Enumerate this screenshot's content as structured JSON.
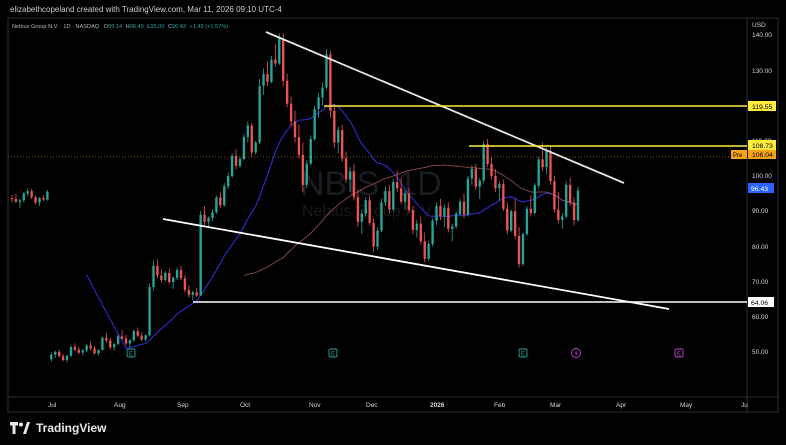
{
  "caption": "elizabethcopeland created with TradingView.com, Mar 11, 2026 09:10 UTC-4",
  "symbol": {
    "name": "Nebius Group N.V. · 1D · NASDAQ",
    "o_label": "O",
    "o_value": "95.14",
    "h_label": "H",
    "h_value": "98.40",
    "l_label": "L",
    "l_value": "95.00",
    "c_label": "C",
    "c_value": "96.43",
    "change": "+1.49 (+1.57%)"
  },
  "watermark": {
    "ticker": "NBIS, 1D",
    "name": "Nebius Group N.V."
  },
  "currency": "USD",
  "price_axis": {
    "ticks": [
      "140.00",
      "130.00",
      "110.00",
      "100.00",
      "90.00",
      "80.00",
      "70.00",
      "60.00",
      "50.00"
    ]
  },
  "time_axis": {
    "ticks": [
      "Jul",
      "Aug",
      "Sep",
      "Oct",
      "Nov",
      "Dec",
      "2026",
      "Feb",
      "Mar",
      "Apr",
      "May",
      "Ju"
    ]
  },
  "price_labels": {
    "level_1": "119.55",
    "level_2": "108.73",
    "pre_tag": "Pre",
    "pre_value": "106.04",
    "last": "96.43",
    "level_3": "64.06"
  },
  "event_markers": [
    "E",
    "E",
    "E",
    "E"
  ],
  "brand": "TradingView",
  "colors": {
    "background": "#000000",
    "up_candle": "#26a69a",
    "down_candle": "#ef5350",
    "ma_fast": "#2a2ecd",
    "ma_slow": "#8a4a4a",
    "resistance": "#ffeb3b",
    "support": "#ffffff",
    "pre_market": "#f7a21b",
    "last_price": "#2962ff"
  },
  "chart_data": {
    "type": "candlestick",
    "price_range": [
      47,
      143
    ],
    "x_range_months": [
      "Jul",
      "Aug",
      "Sep",
      "Oct",
      "Nov",
      "Dec",
      "2026",
      "Feb",
      "Mar",
      "Apr",
      "May",
      "Ju"
    ],
    "candles": [
      [
        94.2,
        95.1,
        93.0,
        94.0
      ],
      [
        94.0,
        95.5,
        92.8,
        93.2
      ],
      [
        93.2,
        94.0,
        91.5,
        93.6
      ],
      [
        93.6,
        96.0,
        93.0,
        95.5
      ],
      [
        95.5,
        97.0,
        94.8,
        96.2
      ],
      [
        96.2,
        96.8,
        94.0,
        94.5
      ],
      [
        94.5,
        95.0,
        92.5,
        93.0
      ],
      [
        93.0,
        94.5,
        92.0,
        94.2
      ],
      [
        94.2,
        95.0,
        93.4,
        93.8
      ],
      [
        93.8,
        96.5,
        93.5,
        96.0
      ],
      [
        48.5,
        50.5,
        47.8,
        49.8
      ],
      [
        49.8,
        51.0,
        48.9,
        50.6
      ],
      [
        50.6,
        51.2,
        49.0,
        49.4
      ],
      [
        49.4,
        50.0,
        47.9,
        48.3
      ],
      [
        48.3,
        49.8,
        47.6,
        49.5
      ],
      [
        49.5,
        52.5,
        49.2,
        52.0
      ],
      [
        52.0,
        53.0,
        50.8,
        51.2
      ],
      [
        51.2,
        52.0,
        49.9,
        50.4
      ],
      [
        50.4,
        51.5,
        49.6,
        51.0
      ],
      [
        51.0,
        52.8,
        50.5,
        52.4
      ],
      [
        52.4,
        53.6,
        51.0,
        51.6
      ],
      [
        51.6,
        52.3,
        49.8,
        50.2
      ],
      [
        50.2,
        51.4,
        49.5,
        51.1
      ],
      [
        51.1,
        55.0,
        51.0,
        54.6
      ],
      [
        54.6,
        56.0,
        53.2,
        53.8
      ],
      [
        53.8,
        54.5,
        51.2,
        51.9
      ],
      [
        51.9,
        53.2,
        51.0,
        52.8
      ],
      [
        52.8,
        55.5,
        52.5,
        55.0
      ],
      [
        55.0,
        56.8,
        54.0,
        54.4
      ],
      [
        54.4,
        55.4,
        52.4,
        53.0
      ],
      [
        53.0,
        54.2,
        52.0,
        53.9
      ],
      [
        53.9,
        57.0,
        53.5,
        56.5
      ],
      [
        56.5,
        57.5,
        54.8,
        55.2
      ],
      [
        55.2,
        56.3,
        53.6,
        54.1
      ],
      [
        54.1,
        55.6,
        53.5,
        55.3
      ],
      [
        55.3,
        70.0,
        55.0,
        69.0
      ],
      [
        69.0,
        76.5,
        68.0,
        75.0
      ],
      [
        75.0,
        76.8,
        71.5,
        72.3
      ],
      [
        72.3,
        74.0,
        70.2,
        71.0
      ],
      [
        71.0,
        73.5,
        70.6,
        73.0
      ],
      [
        73.0,
        74.2,
        69.8,
        70.4
      ],
      [
        70.4,
        72.0,
        68.5,
        71.6
      ],
      [
        71.6,
        74.5,
        71.0,
        73.8
      ],
      [
        73.8,
        75.0,
        71.0,
        71.5
      ],
      [
        71.5,
        72.4,
        67.5,
        68.2
      ],
      [
        68.2,
        69.5,
        66.0,
        66.8
      ],
      [
        66.8,
        68.0,
        65.2,
        67.5
      ],
      [
        67.5,
        68.8,
        66.2,
        66.6
      ],
      [
        66.6,
        90.5,
        66.5,
        89.5
      ],
      [
        89.5,
        92.0,
        86.5,
        87.5
      ],
      [
        87.5,
        89.0,
        85.6,
        88.6
      ],
      [
        88.6,
        91.0,
        87.8,
        90.2
      ],
      [
        90.2,
        95.0,
        89.8,
        94.4
      ],
      [
        94.4,
        96.0,
        91.5,
        92.2
      ],
      [
        92.2,
        98.5,
        91.8,
        97.6
      ],
      [
        97.6,
        101.5,
        96.8,
        100.5
      ],
      [
        100.5,
        107.0,
        100.0,
        106.2
      ],
      [
        106.2,
        108.0,
        102.5,
        103.4
      ],
      [
        103.4,
        106.0,
        102.8,
        105.3
      ],
      [
        105.3,
        112.5,
        105.0,
        111.6
      ],
      [
        111.6,
        116.0,
        110.0,
        114.8
      ],
      [
        114.8,
        115.5,
        106.0,
        107.2
      ],
      [
        107.2,
        110.5,
        106.5,
        110.0
      ],
      [
        110.0,
        128.0,
        109.5,
        126.0
      ],
      [
        126.0,
        131.0,
        123.5,
        129.4
      ],
      [
        129.4,
        133.0,
        126.0,
        127.2
      ],
      [
        127.2,
        134.5,
        126.8,
        133.5
      ],
      [
        133.5,
        138.0,
        131.5,
        132.4
      ],
      [
        132.4,
        141.0,
        132.0,
        139.5
      ],
      [
        139.5,
        141.0,
        126.0,
        127.5
      ],
      [
        127.5,
        129.5,
        120.0,
        121.0
      ],
      [
        121.0,
        123.0,
        114.5,
        116.0
      ],
      [
        116.0,
        119.0,
        110.0,
        111.5
      ],
      [
        111.5,
        115.0,
        105.5,
        106.5
      ],
      [
        106.5,
        110.0,
        96.0,
        98.0
      ],
      [
        98.0,
        105.0,
        97.0,
        104.0
      ],
      [
        104.0,
        112.0,
        103.5,
        111.0
      ],
      [
        111.0,
        120.5,
        110.5,
        119.5
      ],
      [
        119.5,
        124.0,
        117.0,
        122.8
      ],
      [
        122.8,
        127.0,
        120.5,
        125.6
      ],
      [
        125.6,
        136.5,
        125.0,
        135.0
      ],
      [
        135.0,
        136.0,
        117.0,
        119.0
      ],
      [
        119.0,
        121.0,
        108.5,
        110.0
      ],
      [
        110.0,
        114.5,
        107.0,
        113.5
      ],
      [
        113.5,
        115.0,
        104.5,
        105.5
      ],
      [
        105.5,
        107.5,
        98.5,
        99.5
      ],
      [
        99.5,
        103.0,
        96.0,
        101.8
      ],
      [
        101.8,
        104.0,
        93.5,
        94.5
      ],
      [
        94.5,
        96.5,
        86.0,
        87.5
      ],
      [
        87.5,
        91.0,
        84.0,
        89.8
      ],
      [
        89.8,
        94.5,
        89.0,
        93.6
      ],
      [
        93.6,
        95.0,
        86.5,
        87.2
      ],
      [
        87.2,
        88.5,
        79.0,
        80.5
      ],
      [
        80.5,
        86.0,
        79.5,
        85.0
      ],
      [
        85.0,
        94.0,
        84.5,
        93.0
      ],
      [
        93.0,
        97.5,
        92.0,
        96.2
      ],
      [
        96.2,
        98.0,
        90.0,
        91.0
      ],
      [
        91.0,
        99.5,
        90.5,
        98.8
      ],
      [
        98.8,
        102.0,
        96.0,
        97.0
      ],
      [
        97.0,
        100.0,
        92.5,
        93.2
      ],
      [
        93.2,
        96.5,
        91.0,
        95.5
      ],
      [
        95.5,
        97.0,
        90.0,
        90.8
      ],
      [
        90.8,
        92.0,
        84.0,
        85.2
      ],
      [
        85.2,
        88.0,
        83.0,
        87.0
      ],
      [
        87.0,
        89.0,
        81.0,
        82.0
      ],
      [
        82.0,
        84.5,
        76.0,
        77.0
      ],
      [
        77.0,
        82.0,
        76.5,
        81.2
      ],
      [
        81.2,
        88.5,
        80.5,
        87.8
      ],
      [
        87.8,
        93.0,
        86.5,
        92.0
      ],
      [
        92.0,
        94.0,
        88.0,
        89.0
      ],
      [
        89.0,
        92.5,
        86.0,
        91.5
      ],
      [
        91.5,
        93.0,
        84.5,
        85.5
      ],
      [
        85.5,
        87.0,
        82.0,
        86.2
      ],
      [
        86.2,
        90.5,
        85.5,
        89.8
      ],
      [
        89.8,
        94.0,
        89.0,
        93.2
      ],
      [
        93.2,
        95.5,
        88.5,
        89.5
      ],
      [
        89.5,
        100.5,
        89.0,
        99.8
      ],
      [
        99.8,
        103.5,
        98.0,
        102.6
      ],
      [
        102.6,
        104.0,
        96.5,
        97.5
      ],
      [
        97.5,
        100.0,
        94.0,
        99.2
      ],
      [
        99.2,
        110.5,
        98.5,
        109.5
      ],
      [
        109.5,
        111.0,
        103.0,
        104.0
      ],
      [
        104.0,
        106.0,
        99.5,
        100.5
      ],
      [
        100.5,
        102.5,
        96.0,
        97.0
      ],
      [
        97.0,
        99.0,
        93.5,
        98.2
      ],
      [
        98.2,
        99.5,
        90.5,
        91.2
      ],
      [
        91.2,
        93.0,
        84.0,
        85.0
      ],
      [
        85.0,
        91.0,
        84.5,
        90.5
      ],
      [
        90.5,
        94.0,
        82.5,
        83.5
      ],
      [
        83.5,
        86.0,
        74.5,
        75.5
      ],
      [
        75.5,
        84.5,
        75.0,
        84.0
      ],
      [
        84.0,
        92.0,
        83.5,
        91.2
      ],
      [
        91.2,
        95.0,
        89.0,
        90.0
      ],
      [
        90.0,
        98.5,
        89.5,
        97.8
      ],
      [
        97.8,
        106.0,
        97.0,
        105.2
      ],
      [
        105.2,
        110.0,
        102.0,
        103.0
      ],
      [
        103.0,
        108.5,
        101.0,
        107.6
      ],
      [
        107.6,
        109.0,
        98.0,
        99.0
      ],
      [
        99.0,
        100.5,
        90.0,
        91.0
      ],
      [
        91.0,
        96.0,
        87.0,
        88.0
      ],
      [
        88.0,
        90.0,
        85.5,
        89.0
      ],
      [
        89.0,
        99.0,
        88.5,
        98.0
      ],
      [
        98.0,
        100.0,
        92.0,
        93.0
      ],
      [
        93.0,
        94.5,
        86.5,
        88.0
      ],
      [
        88.0,
        97.5,
        87.5,
        96.4
      ]
    ]
  }
}
